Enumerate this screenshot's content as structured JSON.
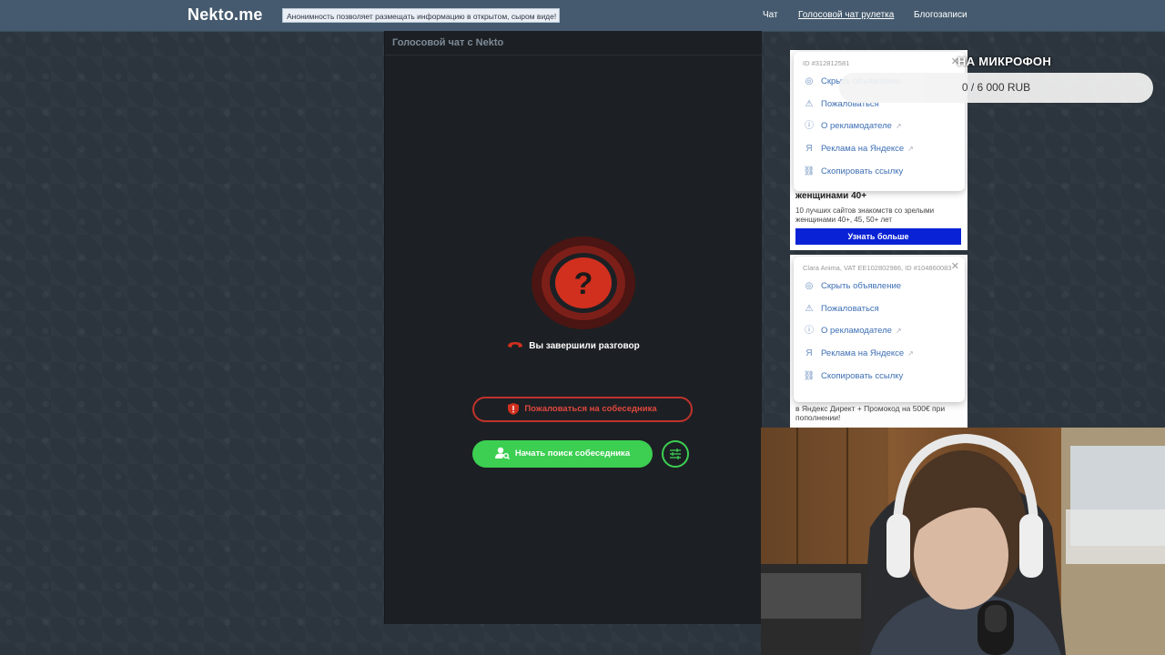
{
  "header": {
    "logo": "Nekto.me",
    "banner_text": "Анонимность позволяет размещать информацию в открытом, сыром виде!",
    "nav": [
      {
        "label": "Чат"
      },
      {
        "label": "Голосовой чат рулетка"
      },
      {
        "label": "Блогозаписи"
      }
    ]
  },
  "chat": {
    "title": "Голосовой чат с Nekto",
    "status_icon": "question-mark-icon",
    "ended_text": "Вы завершили разговор",
    "report_label": "Пожаловаться на собеседника",
    "search_label": "Начать поиск собеседника"
  },
  "ads": {
    "menu1": {
      "meta": "ID #312812581",
      "items": [
        "Скрыть объявление",
        "Пожаловаться",
        "О рекламодателе",
        "Реклама на Яндексе",
        "Скопировать ссылку"
      ]
    },
    "ad1": {
      "title": "женщинами 40+",
      "desc": "10 лучших сайтов знакомств со зрелыми женщинами 40+, 45, 50+ лет",
      "cta": "Узнать больше"
    },
    "menu2": {
      "meta": "Clara Anima, VAT EE102802986, ID #104860083",
      "items": [
        "Скрыть объявление",
        "Пожаловаться",
        "О рекламодателе",
        "Реклама на Яндексе",
        "Скопировать ссылку"
      ]
    },
    "ad2": {
      "desc": "в Яндекс Директ + Промокод на 500€ при пополнении!"
    }
  },
  "stream": {
    "goal_title": "НА МИКРОФОН",
    "goal_progress": "0 / 6 000 RUB"
  },
  "colors": {
    "accent_green": "#3ccf52",
    "danger_red": "#c0322b",
    "header_bg": "#455a6e",
    "ad_cta": "#0a22d6"
  }
}
